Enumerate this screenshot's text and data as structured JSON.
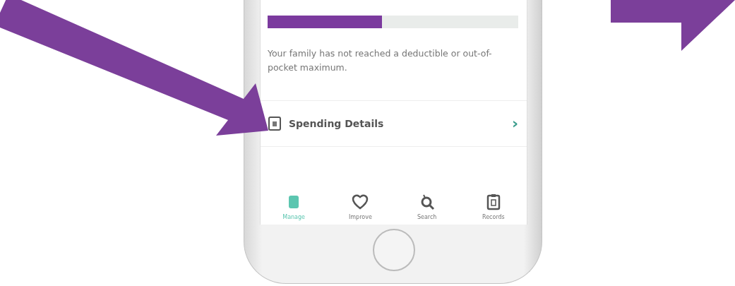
{
  "progress": {
    "level": 0.455
  },
  "message": "Your family has not reached a deductible or out-of-pocket maximum.",
  "spending_details": {
    "label": "Spending Details",
    "chevron": "›"
  },
  "tab_bar": [
    {
      "label": "Manage",
      "selected": true
    },
    {
      "label": "Improve",
      "selected": false
    },
    {
      "label": "Search",
      "selected": false
    },
    {
      "label": "Records",
      "selected": false
    }
  ]
}
